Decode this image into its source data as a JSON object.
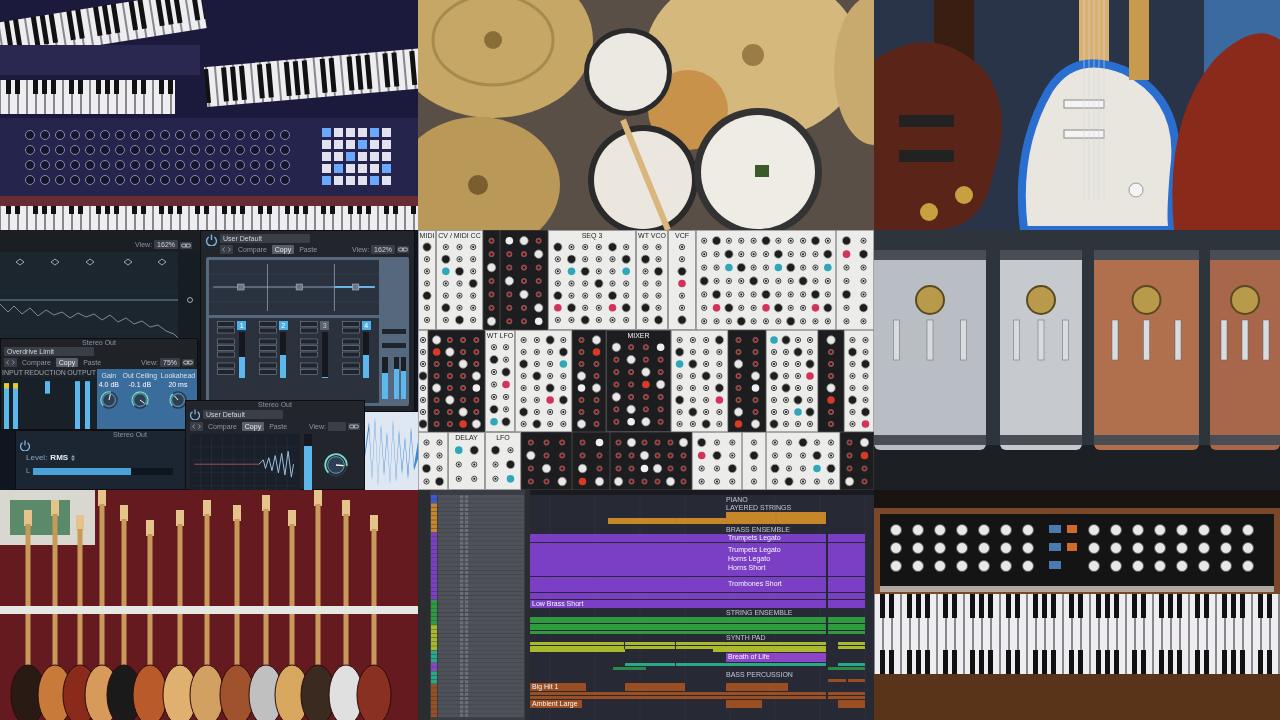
{
  "tiles": [
    {
      "kind": "keyboards"
    },
    {
      "kind": "drums"
    },
    {
      "kind": "guitars"
    },
    {
      "kind": "plugins",
      "eq": {
        "view": "View:",
        "zoom": "162%"
      },
      "multipressor": {
        "preset": "User Default",
        "buttons": [
          {
            "label": "Compare",
            "selected": false
          },
          {
            "label": "Copy",
            "selected": true
          },
          {
            "label": "Paste",
            "selected": false
          }
        ],
        "view": "View:",
        "zoom": "162%",
        "bands": [
          {
            "label": "1",
            "on": true,
            "level": 0.45
          },
          {
            "label": "2",
            "on": true,
            "level": 0.5
          },
          {
            "label": "3",
            "on": false,
            "level": 0.03
          },
          {
            "label": "4",
            "on": true,
            "level": 0.5
          }
        ]
      },
      "limiter": {
        "title": "Stereo Out",
        "preset": "Overdrive Limit",
        "buttons": [
          {
            "label": "Compare",
            "selected": false
          },
          {
            "label": "Copy",
            "selected": true
          },
          {
            "label": "Paste",
            "selected": false
          }
        ],
        "view": "View:",
        "zoom": "75%",
        "meters": [
          "INPUT",
          "REDUCTION",
          "OUTPUT"
        ],
        "knobs": [
          {
            "label": "Gain",
            "reading": "4.0 dB",
            "level": 0.55
          },
          {
            "label": "Out Ceiling",
            "reading": "-0.1 dB",
            "level": 0.97
          },
          {
            "label": "Lookahead",
            "reading": "20 ms",
            "level": 0.35
          }
        ]
      },
      "level_window": {
        "title": "Stereo Out",
        "label": "Level:",
        "mode": "RMS",
        "meter": {
          "channel": "L",
          "level": 0.7
        }
      },
      "analyzer": {
        "title": "Stereo Out",
        "preset": "User Default",
        "buttons": [
          {
            "label": "Compare",
            "selected": false
          },
          {
            "label": "Copy",
            "selected": true
          },
          {
            "label": "Paste",
            "selected": false
          }
        ],
        "view": "View:",
        "output_meter": {
          "level": 0.8
        },
        "knob": {
          "level": 0.85
        }
      }
    },
    {
      "kind": "modular",
      "rows": [
        [
          {
            "kind": "light",
            "label": "MIDI"
          },
          {
            "kind": "light",
            "label": "CV / MIDI CC"
          },
          {
            "kind": "dark"
          },
          {
            "kind": "dark"
          },
          {
            "kind": "light",
            "label": "SEQ 3"
          },
          {
            "kind": "light",
            "label": "WT VCO"
          },
          {
            "kind": "light",
            "label": "VCF"
          },
          {
            "kind": "light"
          },
          {
            "kind": "light"
          }
        ],
        [
          {
            "kind": "light"
          },
          {
            "kind": "dark"
          },
          {
            "kind": "light",
            "label": "WT LFO"
          },
          {
            "kind": "light"
          },
          {
            "kind": "dark"
          },
          {
            "kind": "dark",
            "label": "MIXER"
          },
          {
            "kind": "light"
          },
          {
            "kind": "dark"
          },
          {
            "kind": "light"
          },
          {
            "kind": "dark"
          },
          {
            "kind": "light"
          }
        ],
        [
          {
            "kind": "light"
          },
          {
            "kind": "light",
            "label": "DELAY"
          },
          {
            "kind": "light",
            "label": "LFO"
          },
          {
            "kind": "dark"
          },
          {
            "kind": "dark"
          },
          {
            "kind": "dark"
          },
          {
            "kind": "light"
          },
          {
            "kind": "light"
          },
          {
            "kind": "light"
          },
          {
            "kind": "dark"
          }
        ]
      ]
    },
    {
      "kind": "snares"
    },
    {
      "kind": "guitar-wall"
    },
    {
      "kind": "daw",
      "sections": [
        {
          "title": "PIANO"
        },
        {
          "title": "LAYERED STRINGS"
        },
        {
          "title": "BRASS ENSEMBLE"
        },
        {
          "title": "STRING ENSEMBLE"
        },
        {
          "title": "SYNTH PAD"
        },
        {
          "title": "BASS PERCUSSION"
        }
      ],
      "clips": [
        {
          "color": "#c8862a"
        },
        {
          "color": "#c8862a"
        },
        {
          "color": "#c8862a"
        },
        {
          "color": "#c8862a"
        },
        {
          "color": "#c8862a"
        },
        {
          "color": "#c8862a"
        },
        {
          "color": "#c8862a"
        },
        {
          "color": "#c8862a"
        },
        {
          "color": "#c8862a"
        },
        {
          "color": "#c8862a"
        },
        {
          "color": "#c8862a"
        },
        {
          "color": "#c8862a"
        },
        {
          "color": "#7b3fc6"
        },
        {
          "color": "#7b3fc6",
          "label": "Trumpets Legato"
        },
        {
          "color": "#7b3fc6"
        },
        {
          "color": "#7b3fc6"
        },
        {
          "color": "#7b3fc6"
        },
        {
          "color": "#7b3fc6"
        },
        {
          "color": "#7b3fc6"
        },
        {
          "color": "#7b3fc6",
          "label": "Trumpets Legato"
        },
        {
          "color": "#7b3fc6"
        },
        {
          "color": "#7b3fc6"
        },
        {
          "color": "#7b3fc6",
          "label": "Horns Legato"
        },
        {
          "color": "#7b3fc6"
        },
        {
          "color": "#7b3fc6"
        },
        {
          "color": "#7b3fc6",
          "label": "Horns Short"
        },
        {
          "color": "#7b3fc6"
        },
        {
          "color": "#7b3fc6"
        },
        {
          "color": "#7b3fc6"
        },
        {
          "color": "#7b3fc6"
        },
        {
          "color": "#7b3fc6"
        },
        {
          "color": "#7b3fc6"
        },
        {
          "color": "#7b3fc6"
        },
        {
          "color": "#7b3fc6"
        },
        {
          "color": "#7b3fc6",
          "label": "Trombones Short"
        },
        {
          "color": "#7b3fc6"
        },
        {
          "color": "#7b3fc6"
        },
        {
          "color": "#7b3fc6"
        },
        {
          "color": "#7b3fc6"
        },
        {
          "color": "#7b3fc6"
        },
        {
          "color": "#7b3fc6"
        },
        {
          "color": "#7b3fc6"
        },
        {
          "color": "#7b3fc6"
        },
        {
          "color": "#7b3fc6"
        },
        {
          "color": "#7b3fc6"
        },
        {
          "color": "#7b3fc6",
          "label": "Low Brass Short"
        },
        {
          "color": "#7b3fc6"
        },
        {
          "color": "#7b3fc6"
        },
        {
          "color": "#2e9c3e"
        },
        {
          "color": "#2e9c3e"
        },
        {
          "color": "#2e9c3e"
        },
        {
          "color": "#2e9c3e"
        },
        {
          "color": "#2e9c3e"
        },
        {
          "color": "#2e9c3e"
        },
        {
          "color": "#2e9c3e"
        },
        {
          "color": "#2e9c3e"
        },
        {
          "color": "#2e9c3e"
        },
        {
          "color": "#2e9c3e"
        },
        {
          "color": "#a9b92a"
        },
        {
          "color": "#a9b92a"
        },
        {
          "color": "#a9b92a"
        },
        {
          "color": "#a9b92a"
        },
        {
          "color": "#a9b92a"
        },
        {
          "color": "#a9b92a"
        },
        {
          "color": "#a9b92a"
        },
        {
          "color": "#a9b92a"
        },
        {
          "color": "#a9b92a"
        },
        {
          "color": "#a9b92a"
        },
        {
          "color": "#a9b92a"
        },
        {
          "color": "#a9b92a"
        },
        {
          "color": "#a9b92a"
        },
        {
          "color": "#a9b92a"
        },
        {
          "color": "#8e44c8",
          "label": "Breath of Life"
        },
        {
          "color": "#2aa88a"
        },
        {
          "color": "#2aa88a"
        },
        {
          "color": "#2aa88a"
        },
        {
          "color": "#2aa88a"
        },
        {
          "color": "#2aa88a"
        },
        {
          "color": "#2a8a4a"
        },
        {
          "color": "#2a8a4a"
        },
        {
          "color": "#9a4e22"
        },
        {
          "color": "#9a4e22"
        },
        {
          "color": "#9a4e22",
          "label": "Big Hit 1"
        },
        {
          "color": "#9a4e22"
        },
        {
          "color": "#9a4e22"
        },
        {
          "color": "#9a4e22"
        },
        {
          "color": "#9a4e22"
        },
        {
          "color": "#9a4e22"
        },
        {
          "color": "#9a4e22"
        },
        {
          "color": "#9a4e22"
        },
        {
          "color": "#9a4e22"
        },
        {
          "color": "#9a4e22",
          "label": "Ambient Large"
        },
        {
          "color": "#9a4e22"
        },
        {
          "color": "#9a4e22"
        }
      ]
    },
    {
      "kind": "synth"
    }
  ]
}
